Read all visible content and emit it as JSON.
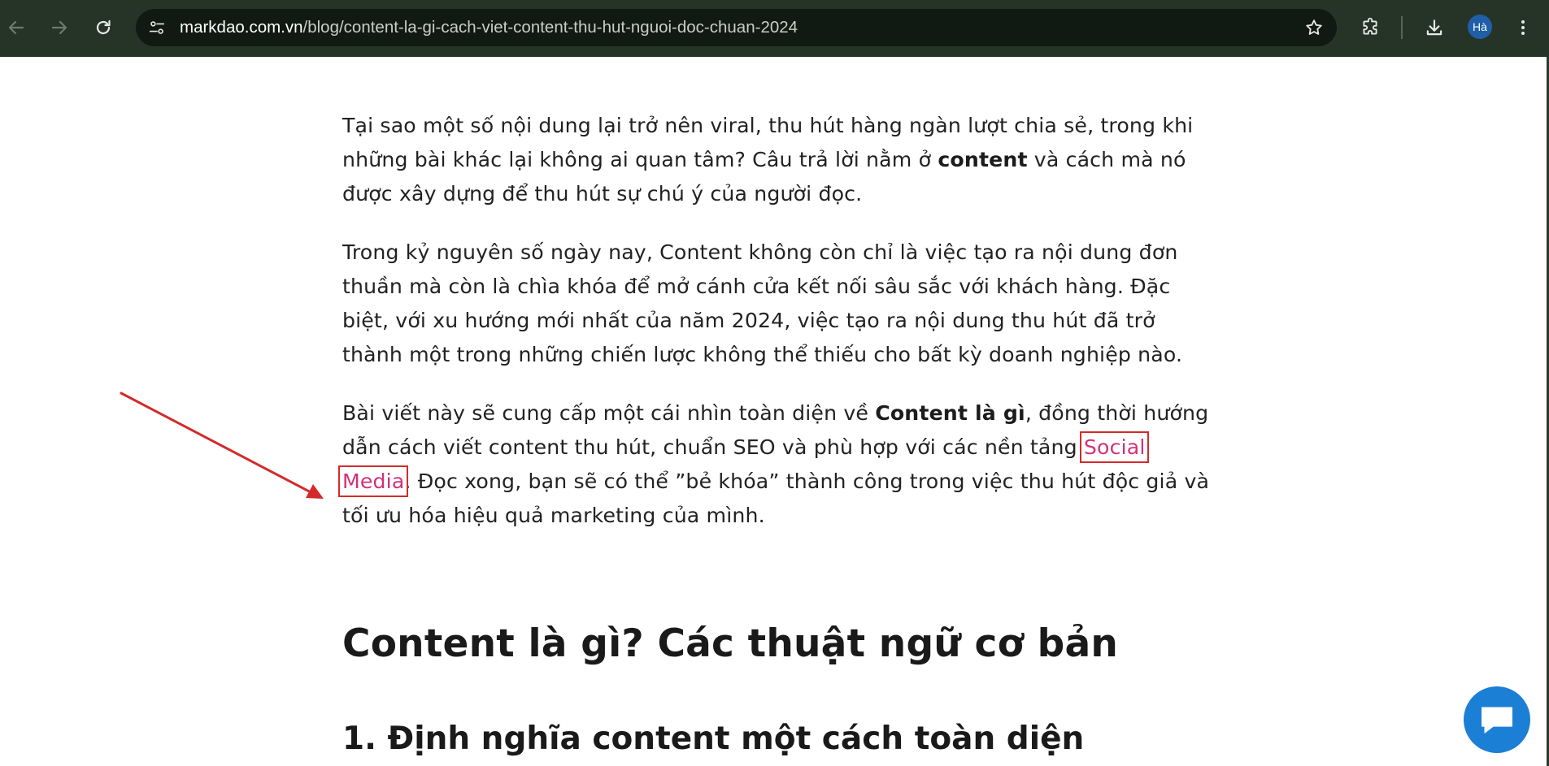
{
  "browser": {
    "url_host": "markdao.com.vn",
    "url_path": "/blog/content-la-gi-cach-viet-content-thu-hut-nguoi-doc-chuan-2024",
    "profile_initials": "Hà",
    "icons": {
      "back": "arrow-left-icon",
      "forward": "arrow-right-icon",
      "reload": "reload-icon",
      "site_info": "tune-icon",
      "bookmark": "star-icon",
      "extensions": "puzzle-icon",
      "downloads": "download-icon",
      "menu": "kebab-menu-icon"
    },
    "colors": {
      "toolbar": "#253426",
      "omnibox": "#111a12",
      "avatar": "#1f5fa8"
    }
  },
  "article": {
    "p1": {
      "a": "Tại sao một số nội dung lại trở nên viral, thu hút hàng ngàn lượt chia sẻ, trong khi những bài khác lại không ai quan tâm? Câu trả lời nằm ở ",
      "bold": "content",
      "b": " và cách mà nó được xây dựng để thu hút sự chú ý của người đọc."
    },
    "p2": "Trong kỷ nguyên số ngày nay, Content không còn chỉ là việc tạo ra nội dung đơn thuần mà còn là chìa khóa để mở cánh cửa kết nối sâu sắc với khách hàng. Đặc biệt, với xu hướng mới nhất của năm 2024, việc tạo ra nội dung thu hút đã trở thành một trong những chiến lược không thể thiếu cho bất kỳ doanh nghiệp nào.",
    "p3": {
      "a": "Bài viết này sẽ cung cấp một cái nhìn toàn diện về ",
      "bold": "Content là gì",
      "b": ", đồng thời hướng dẫn cách viết content thu hút, chuẩn SEO và phù hợp với các nền tảng ",
      "link": "Social Media",
      "c": ". Đọc xong, bạn sẽ có thể ”bẻ khóa” thành công trong việc thu hút độc giả và tối ưu hóa hiệu quả marketing của mình."
    },
    "h2": "Content là gì? Các thuật ngữ cơ bản",
    "h3": "1. Định nghĩa content một cách toàn diện",
    "colors": {
      "link": "#d4317a",
      "highlight_box": "#d42a2a",
      "annotation_arrow": "#d42a2a"
    }
  },
  "widgets": {
    "chat_icon": "chat-bubble-icon",
    "colors": {
      "chat_button": "#1c7fd6"
    }
  }
}
